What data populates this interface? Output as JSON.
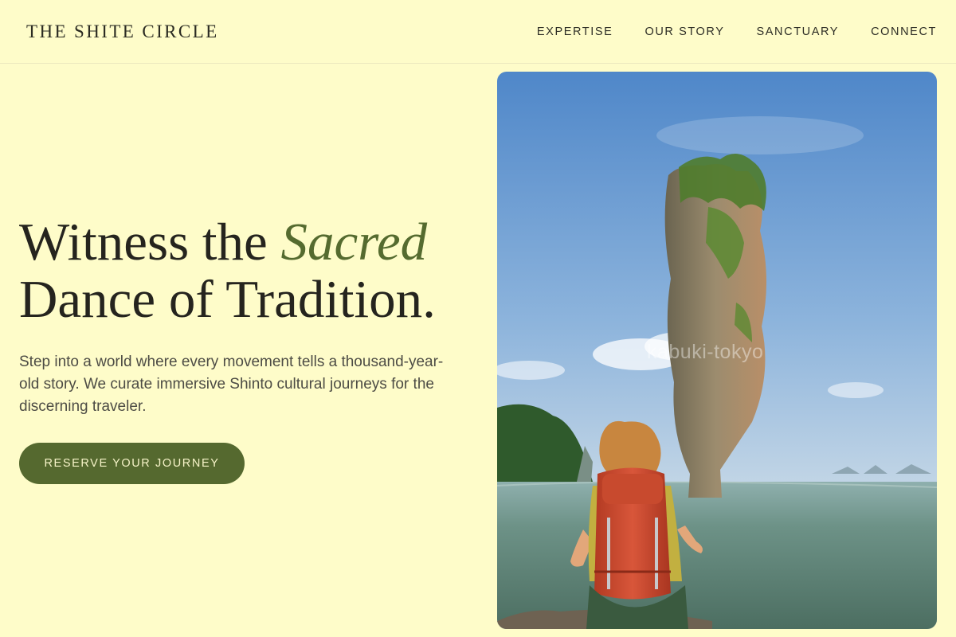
{
  "header": {
    "logo": "THE SHITE CIRCLE",
    "nav": [
      "EXPERTISE",
      "OUR STORY",
      "SANCTUARY",
      "CONNECT"
    ]
  },
  "hero": {
    "title_part1": "Witness the ",
    "title_accent": "Sacred",
    "title_part2": "Dance of Tradition.",
    "subtitle": "Step into a world where every movement tells a thousand-year-old story. We curate immersive Shinto cultural journeys for the discerning traveler.",
    "cta_label": "RESERVE YOUR JOURNEY"
  },
  "image": {
    "watermark": "kabuki-tokyo"
  },
  "colors": {
    "background": "#fefcc9",
    "accent": "#556b2f",
    "button": "#55692f",
    "text": "#25241e"
  }
}
